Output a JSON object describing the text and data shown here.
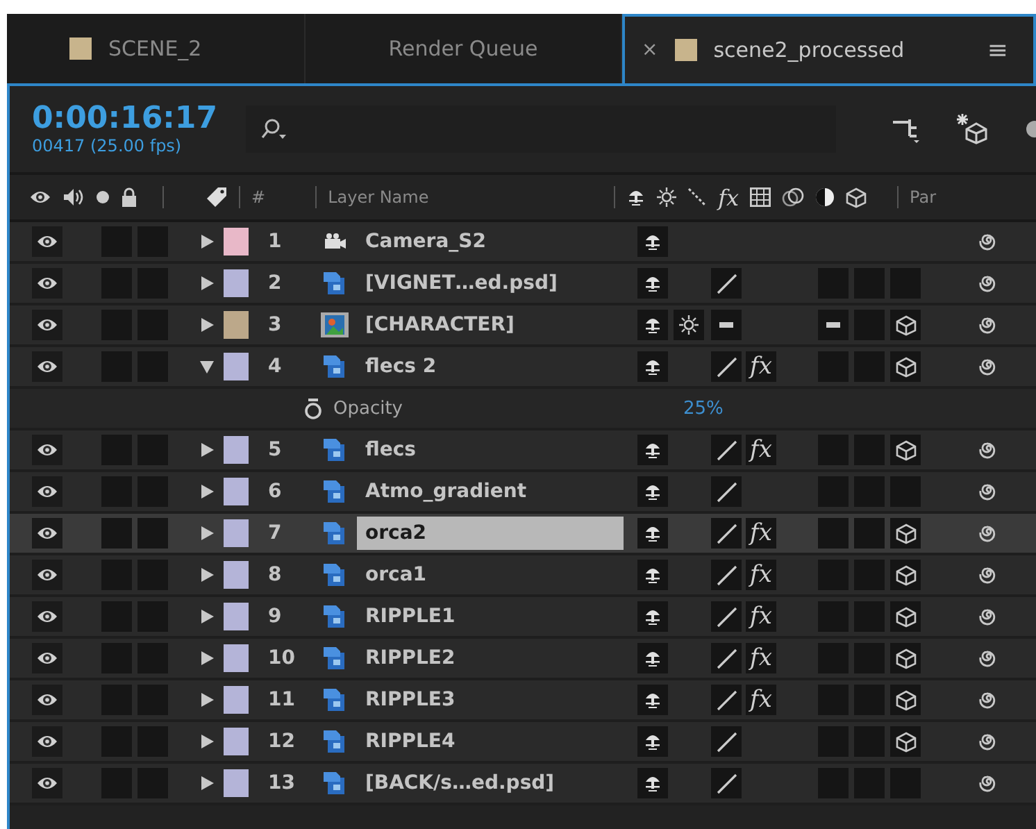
{
  "tabs": [
    {
      "label": "SCENE_2",
      "kind": "comp",
      "selected": false
    },
    {
      "label": "Render Queue",
      "kind": "queue",
      "selected": false
    },
    {
      "label": "scene2_processed",
      "kind": "comp",
      "selected": true,
      "close": "×",
      "menu": "≡"
    }
  ],
  "timecode": {
    "time": "0:00:16:17",
    "frames": "00417 (25.00 fps)"
  },
  "header": {
    "number": "#",
    "layer_name": "Layer Name",
    "effects": "fx",
    "parent": "Par"
  },
  "layers": [
    {
      "number": "1",
      "name": "Camera_S2",
      "kind": "camera",
      "color": "#e8b8c8",
      "expanded": false,
      "selected": false
    },
    {
      "number": "2",
      "name": "[VIGNET…ed.psd]",
      "kind": "psd",
      "color": "#b4b4d8",
      "expanded": false,
      "selected": false,
      "collapse": false,
      "draft_quality": false,
      "frame_blend": false,
      "three_d": false
    },
    {
      "number": "3",
      "name": "[CHARACTER]",
      "kind": "footage",
      "color": "#bca88a",
      "expanded": false,
      "selected": false,
      "collapse": true,
      "draft_quality": true,
      "frame_blend": true,
      "three_d": true
    },
    {
      "number": "4",
      "name": "flecs 2",
      "kind": "psd",
      "color": "#b4b4d8",
      "expanded": true,
      "selected": false,
      "collapse": false,
      "draft_quality": false,
      "effects": "fx",
      "frame_blend": false,
      "three_d": true,
      "children": [
        {
          "name": "Opacity",
          "value": "25%"
        }
      ]
    },
    {
      "number": "5",
      "name": "flecs",
      "kind": "psd",
      "color": "#b4b4d8",
      "expanded": false,
      "selected": false,
      "collapse": false,
      "draft_quality": false,
      "effects": "fx",
      "frame_blend": false,
      "three_d": true
    },
    {
      "number": "6",
      "name": "Atmo_gradient",
      "kind": "psd",
      "color": "#b4b4d8",
      "expanded": false,
      "selected": false,
      "collapse": false,
      "draft_quality": false,
      "frame_blend": false,
      "three_d": false
    },
    {
      "number": "7",
      "name": "orca2",
      "kind": "psd",
      "color": "#b4b4d8",
      "expanded": false,
      "selected": true,
      "collapse": false,
      "draft_quality": false,
      "effects": "fx",
      "frame_blend": false,
      "three_d": true
    },
    {
      "number": "8",
      "name": "orca1",
      "kind": "psd",
      "color": "#b4b4d8",
      "expanded": false,
      "selected": false,
      "collapse": false,
      "draft_quality": false,
      "effects": "fx",
      "frame_blend": false,
      "three_d": true
    },
    {
      "number": "9",
      "name": "RIPPLE1",
      "kind": "psd",
      "color": "#b4b4d8",
      "expanded": false,
      "selected": false,
      "collapse": false,
      "draft_quality": false,
      "effects": "fx",
      "frame_blend": false,
      "three_d": true
    },
    {
      "number": "10",
      "name": "RIPPLE2",
      "kind": "psd",
      "color": "#b4b4d8",
      "expanded": false,
      "selected": false,
      "collapse": false,
      "draft_quality": false,
      "effects": "fx",
      "frame_blend": false,
      "three_d": true
    },
    {
      "number": "11",
      "name": "RIPPLE3",
      "kind": "psd",
      "color": "#b4b4d8",
      "expanded": false,
      "selected": false,
      "collapse": false,
      "draft_quality": false,
      "effects": "fx",
      "frame_blend": false,
      "three_d": true
    },
    {
      "number": "12",
      "name": "RIPPLE4",
      "kind": "psd",
      "color": "#b4b4d8",
      "expanded": false,
      "selected": false,
      "collapse": false,
      "draft_quality": false,
      "frame_blend": false,
      "three_d": true
    },
    {
      "number": "13",
      "name": "[BACK/s…ed.psd]",
      "kind": "psd",
      "color": "#b4b4d8",
      "expanded": false,
      "selected": false,
      "collapse": false,
      "draft_quality": false,
      "frame_blend": false,
      "three_d": false
    }
  ]
}
